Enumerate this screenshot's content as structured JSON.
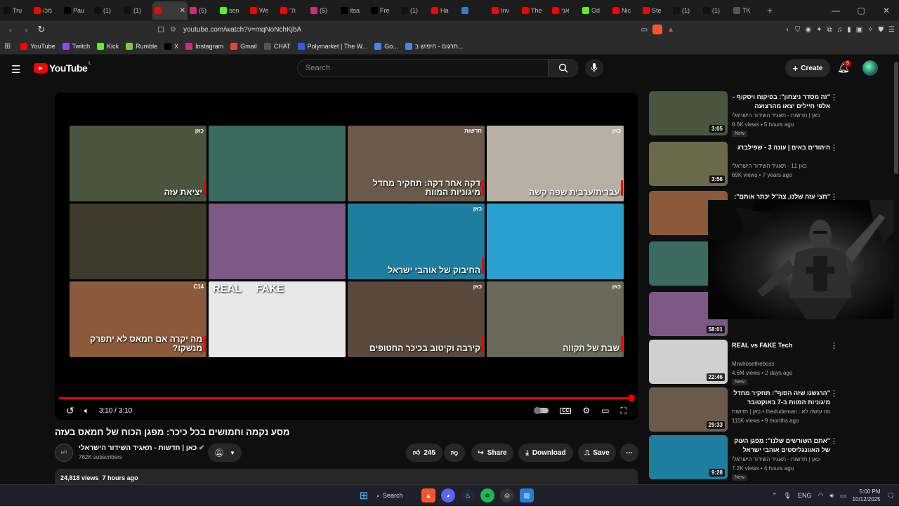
{
  "browser": {
    "tabs": [
      {
        "label": "Tru",
        "icon": "tiktok-icon",
        "color": "#111"
      },
      {
        "label": "מכו",
        "icon": "youtube-icon",
        "color": "#ff0000"
      },
      {
        "label": "Pau",
        "icon": "x-icon",
        "color": "#000"
      },
      {
        "label": "(1)",
        "icon": "tiktok-icon",
        "color": "#111"
      },
      {
        "label": "(1)",
        "icon": "tiktok-icon",
        "color": "#111"
      },
      {
        "label": "",
        "icon": "youtube-icon",
        "color": "#ff0000",
        "active": true
      },
      {
        "label": "(5)",
        "icon": "instagram-icon",
        "color": "#d62976"
      },
      {
        "label": "sen",
        "icon": "kick-icon",
        "color": "#53fc18"
      },
      {
        "label": "We",
        "icon": "youtube-icon",
        "color": "#ff0000"
      },
      {
        "label": "\"ה",
        "icon": "youtube-icon",
        "color": "#ff0000"
      },
      {
        "label": "(5)",
        "icon": "instagram-icon",
        "color": "#d62976"
      },
      {
        "label": "itsa",
        "icon": "x-icon",
        "color": "#000"
      },
      {
        "label": "Fre",
        "icon": "x-icon",
        "color": "#000"
      },
      {
        "label": "(1)",
        "icon": "tiktok-icon",
        "color": "#111"
      },
      {
        "label": "Ha",
        "icon": "youtube-icon",
        "color": "#ff0000"
      },
      {
        "label": "",
        "icon": "app-icon",
        "color": "#2b7bd8"
      },
      {
        "label": "Inv",
        "icon": "youtube-icon",
        "color": "#ff0000"
      },
      {
        "label": "The",
        "icon": "youtube-icon",
        "color": "#ff0000"
      },
      {
        "label": "אני",
        "icon": "youtube-icon",
        "color": "#ff0000"
      },
      {
        "label": "Od",
        "icon": "kick-icon",
        "color": "#53fc18"
      },
      {
        "label": "Nic",
        "icon": "youtube-icon",
        "color": "#ff0000"
      },
      {
        "label": "Ste",
        "icon": "youtube-icon",
        "color": "#ff0000"
      },
      {
        "label": "(1)",
        "icon": "tiktok-icon",
        "color": "#111"
      },
      {
        "label": "(1)",
        "icon": "tiktok-icon",
        "color": "#111"
      },
      {
        "label": "TK",
        "icon": "globe-icon",
        "color": "#555"
      }
    ],
    "url": "youtube.com/watch?v=mqNoNchKjbA",
    "bookmarks": [
      {
        "label": "YouTube",
        "icon": "youtube-icon",
        "color": "#ff0000"
      },
      {
        "label": "Twitch",
        "icon": "twitch-icon",
        "color": "#9146ff"
      },
      {
        "label": "Kick",
        "icon": "kick-icon",
        "color": "#53fc18"
      },
      {
        "label": "Rumble",
        "icon": "rumble-icon",
        "color": "#85c742"
      },
      {
        "label": "X",
        "icon": "x-icon",
        "color": "#000"
      },
      {
        "label": "Instagram",
        "icon": "instagram-icon",
        "color": "#d62976"
      },
      {
        "label": "Gmail",
        "icon": "gmail-icon",
        "color": "#ea4335"
      },
      {
        "label": "CHAT",
        "icon": "chatgpt-icon",
        "color": "#555"
      },
      {
        "label": "Polymarket | The W...",
        "icon": "polymarket-icon",
        "color": "#2d5cf6"
      },
      {
        "label": "Go...",
        "icon": "google-icon",
        "color": "#4285f4"
      },
      {
        "label": "תרגום - חיפוש ב...",
        "icon": "google-icon",
        "color": "#4285f4"
      }
    ]
  },
  "youtube": {
    "logo": "YouTube",
    "country": "IL",
    "search_placeholder": "Search",
    "create_label": "Create",
    "notif_count": "5"
  },
  "player": {
    "time": "3:10 / 3:10",
    "progress": 1.0,
    "endscreen": [
      {
        "caption": "יציאת עזה",
        "brand": "כאן",
        "bg": "#4a5540"
      },
      {
        "caption": "",
        "brand": "",
        "bg": "#3a6a60"
      },
      {
        "caption": "דקה אחר דקה: תחקיר מחדל מיגוניות המוות",
        "brand": "חדשות",
        "bg": "#6a5a4a"
      },
      {
        "caption": "עברית/ערבית שפה קשה",
        "brand": "כאן",
        "bg": "#b8b0a4"
      },
      {
        "caption": "",
        "brand": "",
        "bg": "#3d3a2c"
      },
      {
        "caption": "",
        "brand": "",
        "bg": "#7d5a86"
      },
      {
        "caption": "החיבוק של אוהבי ישראל",
        "brand": "כאן",
        "bg": "#1d7ea0"
      },
      {
        "caption": "",
        "brand": "",
        "bg": "#2aa0d0"
      },
      {
        "caption": "מה יקרה אם חמאס לא יתפרק מנשקו?",
        "brand": "C14",
        "bg": "#8a5a3a"
      },
      {
        "caption": "REAL     FAKE",
        "brand": "",
        "bg": "#e8e8e8"
      },
      {
        "caption": "קירבה וקיטוב בכיכר החטופים",
        "brand": "כאן",
        "bg": "#5a4a3e"
      },
      {
        "caption": "שבת של תקווה",
        "brand": "כאן",
        "bg": "#6a6a5a"
      }
    ]
  },
  "video": {
    "title": "מסע נקמה וחמושים בכל כיכר: מפגן הכוח של חמאס בעזה",
    "channel": "כאן | חדשות - תאגיד השידור הישראלי",
    "subscribers": "762K subscribers",
    "likes": "245",
    "share": "Share",
    "download": "Download",
    "save": "Save",
    "views": "24,818 views",
    "age": "7 hours ago"
  },
  "sidebar": [
    {
      "title": "\"זה מסדר ניצחון\": בפיקוח ויסקוף - אלפי חיילים יצאו מהרצועה לקראת...",
      "channel": "כאן | חדשות - תאגיד השידור הישראלי",
      "views": "9.6K views • 5 hours ago",
      "dur": "3:05",
      "new": "New",
      "bg": "#4a5540"
    },
    {
      "title": "היהודים באים | עונה 3 - שפילברג",
      "channel": "כאן 11 - תאגיד השידור הישראלי",
      "views": "69K views • 7 years ago",
      "dur": "3:56",
      "new": "",
      "bg": "#6a6a4a"
    },
    {
      "title": "\"חצי עזה שלנו, צה\"ל יכתר אותם\": מה",
      "channel": "",
      "views": "",
      "dur": "",
      "new": "",
      "bg": "#8a5a3a"
    },
    {
      "title": "",
      "channel": "",
      "views": "",
      "dur": "",
      "new": "",
      "bg": "#3a6a60"
    },
    {
      "title": "",
      "channel": "",
      "views": "",
      "dur": "58:01",
      "new": "",
      "bg": "#7d5a86"
    },
    {
      "title": "REAL vs FAKE Tech",
      "channel": "Mrwhosetheboss",
      "views": "4.6M views • 2 days ago",
      "dur": "22:46",
      "new": "New",
      "bg": "#d0d0d0",
      "ltr": true
    },
    {
      "title": "\"הרגשנו שזה הסוף\": תחקיר מחדל מיגוניות המוות ב-7 באוקטובר",
      "channel": "כאן | חדשות • thedudeman : הזה עושה לא",
      "views": "111K views • 9 months ago",
      "dur": "29:33",
      "new": "",
      "bg": "#6a5a4a"
    },
    {
      "title": "\"אתם השורשים שלנו\": מפגן העוק של האוונגליסטים אוהבי ישראל בירושלים",
      "channel": "כאן | חדשות - תאגיד השידור הישראלי",
      "views": "7.2K views • 4 hours ago",
      "dur": "9:28",
      "new": "New",
      "bg": "#1d7ea0"
    }
  ],
  "taskbar": {
    "search": "Search",
    "lang": "ENG",
    "time": "5:00 PM",
    "date": "10/12/2025"
  }
}
